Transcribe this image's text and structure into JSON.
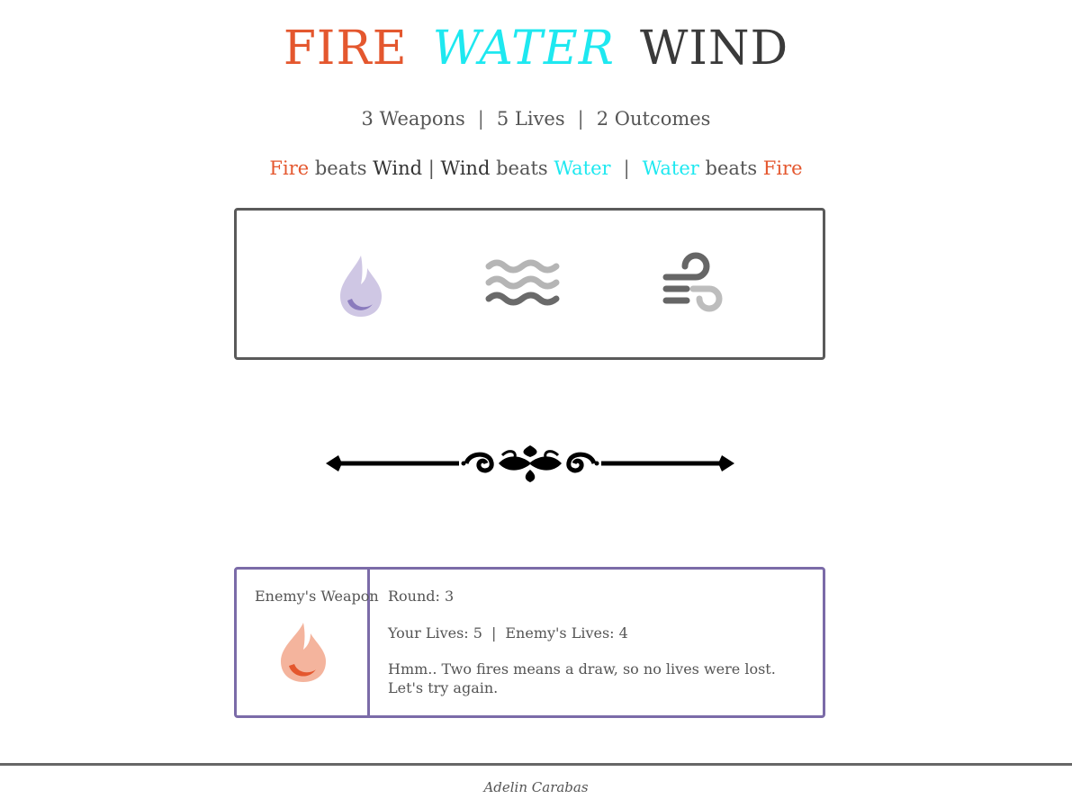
{
  "title": {
    "fire": "FIRE",
    "water": "WATER",
    "wind": "WIND"
  },
  "stats": {
    "weapons": "3 Weapons",
    "lives": "5 Lives",
    "outcomes": "2 Outcomes",
    "separator": "|"
  },
  "rules": {
    "r1_a": "Fire",
    "r1_verb": " beats ",
    "r1_b": "Wind",
    "inner_sep": " | ",
    "r2_a": "Wind",
    "r2_verb": " beats ",
    "r2_b": "Water",
    "outer_sep": "|",
    "r3_a": "Water",
    "r3_verb": " beats ",
    "r3_b": "Fire"
  },
  "weapons": [
    {
      "name": "fire",
      "icon": "fire-icon"
    },
    {
      "name": "water",
      "icon": "water-icon"
    },
    {
      "name": "wind",
      "icon": "wind-icon"
    }
  ],
  "result": {
    "enemy_label": "Enemy's Weapon",
    "enemy_icon": "fire-icon",
    "round": "Round: 3",
    "your_lives": "Your Lives: 5",
    "lives_separator": "|",
    "enemy_lives": "Enemy's Lives: 4",
    "message": "Hmm.. Two fires means a draw, so no lives were lost. Let's try again."
  },
  "footer": {
    "author": "Adelin Carabas"
  },
  "colors": {
    "fire": "#e4572e",
    "water": "#1ee8f0",
    "wind": "#3a3a3a",
    "accent": "#7b6ba8",
    "border": "#5a5a5a"
  }
}
